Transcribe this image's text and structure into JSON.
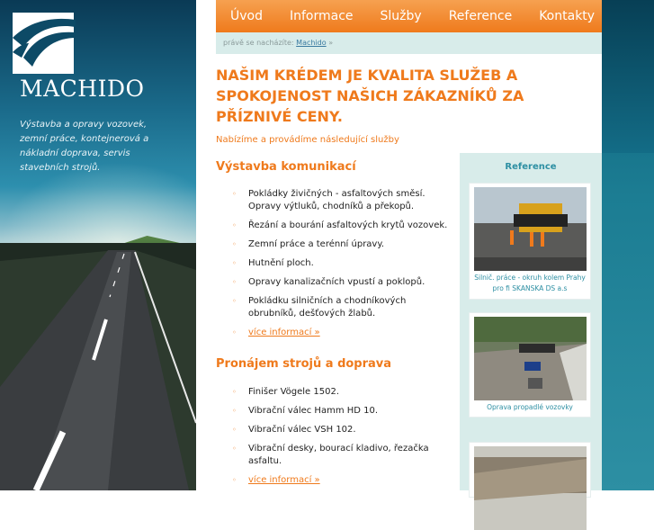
{
  "brand": {
    "name": "MACHIDO",
    "tagline": "Výstavba a opravy vozovek, zemní práce, kontejnerová a nákladní doprava, servis stavebních strojů."
  },
  "nav": {
    "items": [
      "Úvod",
      "Informace",
      "Služby",
      "Reference",
      "Kontakty"
    ]
  },
  "breadcrumb": {
    "prefix": "právě se nacházíte:",
    "current": "Machido",
    "suffix": "»"
  },
  "main": {
    "headline": "NAŠIM KRÉDEM JE KVALITA SLUŽEB A SPOKOJENOST NAŠICH ZÁKAZNÍKŮ ZA PŘÍZNIVÉ CENY.",
    "intro": "Nabízíme a provádíme následující služby",
    "sections": [
      {
        "title": "Výstavba komunikací",
        "items": [
          "Pokládky živičných - asfaltových směsí. Opravy výtluků, chodníků a překopů.",
          "Řezání a bourání asfaltových krytů vozovek.",
          "Zemní práce a terénní úpravy.",
          "Hutnění ploch.",
          "Opravy kanalizačních vpustí a poklopů.",
          "Pokládku silničních a chodníkových obrubníků, dešťových žlabů."
        ],
        "more": "více informací »"
      },
      {
        "title": "Pronájem strojů a doprava",
        "items": [
          "Finišer Vögele 1502.",
          "Vibrační válec Hamm HD 10.",
          "Vibrační válec VSH 102.",
          "Vibrační desky, bourací kladivo, řezačka asfaltu."
        ],
        "more": "více informací »"
      }
    ]
  },
  "reference": {
    "title": "Reference",
    "cards": [
      {
        "caption": "Silnič. práce - okruh kolem Prahy pro fi SKANSKA DS a.s"
      },
      {
        "caption": "Oprava propadlé vozovky"
      },
      {
        "caption": ""
      }
    ]
  },
  "colors": {
    "accent": "#ef7a1c",
    "teal": "#2d8fa3",
    "panel": "#d8ecea"
  }
}
